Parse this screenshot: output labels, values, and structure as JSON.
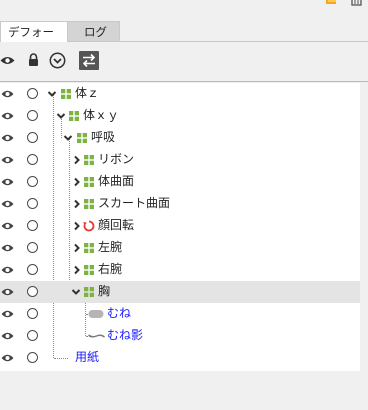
{
  "tabs": [
    {
      "label": "デフォーマ",
      "active": true
    },
    {
      "label": "ログ",
      "active": false
    }
  ],
  "toolbar": {
    "icons": [
      "eye-icon",
      "lock-icon",
      "circle-chevron-down-icon",
      "swap-icon"
    ]
  },
  "tree": {
    "rows": [
      {
        "label": "体ｚ",
        "icon": "warp-grid-icon",
        "expander": "open",
        "depth": 0
      },
      {
        "label": "体ｘｙ",
        "icon": "warp-grid-icon",
        "expander": "open",
        "depth": 1
      },
      {
        "label": "呼吸",
        "icon": "warp-grid-icon",
        "expander": "open",
        "depth": 2
      },
      {
        "label": "リボン",
        "icon": "warp-grid-icon",
        "expander": "closed",
        "depth": 3
      },
      {
        "label": "体曲面",
        "icon": "warp-grid-icon",
        "expander": "closed",
        "depth": 3
      },
      {
        "label": "スカート曲面",
        "icon": "warp-grid-icon",
        "expander": "closed",
        "depth": 3
      },
      {
        "label": "顔回転",
        "icon": "rotation-icon",
        "expander": "closed",
        "depth": 3
      },
      {
        "label": "左腕",
        "icon": "warp-grid-icon",
        "expander": "closed",
        "depth": 3
      },
      {
        "label": "右腕",
        "icon": "warp-grid-icon",
        "expander": "closed",
        "depth": 3
      },
      {
        "label": "胸",
        "icon": "warp-grid-icon",
        "expander": "open",
        "depth": 3,
        "selected": true
      },
      {
        "label": "むね",
        "icon": "art-mesh-icon",
        "expander": "none",
        "depth": 4,
        "link": true
      },
      {
        "label": "むね影",
        "icon": "art-path-icon",
        "expander": "none",
        "depth": 4,
        "link": true
      },
      {
        "label": "用紙",
        "icon": "none",
        "expander": "none",
        "depth": 0,
        "link": true
      }
    ]
  },
  "colors": {
    "link": "#1a1aff",
    "warp_green": "#7cb342",
    "rotation_red": "#e53935",
    "selected_row": "#e4e4e4",
    "toolbar_swap_bg": "#555555"
  }
}
